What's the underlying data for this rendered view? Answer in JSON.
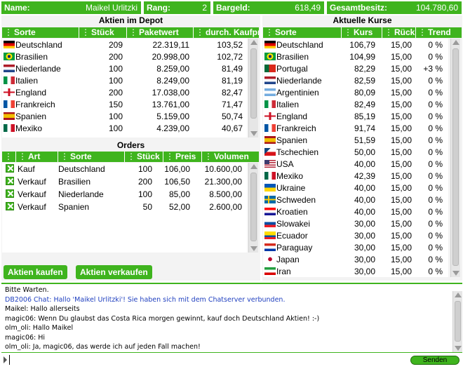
{
  "header": {
    "name_label": "Name:",
    "name_value": "Maikel Urlitzki",
    "rang_label": "Rang:",
    "rang_value": "2",
    "bargeld_label": "Bargeld:",
    "bargeld_value": "618,49",
    "gesamt_label": "Gesamtbesitz:",
    "gesamt_value": "104.780,60"
  },
  "depot": {
    "title": "Aktien im Depot",
    "columns": [
      "Sorte",
      "Stück",
      "Paketwert",
      "durch. Kaufpr."
    ],
    "rows": [
      {
        "flag": "de",
        "sorte": "Deutschland",
        "stueck": "209",
        "paketwert": "22.319,11",
        "kaufpr": "103,52"
      },
      {
        "flag": "br",
        "sorte": "Brasilien",
        "stueck": "200",
        "paketwert": "20.998,00",
        "kaufpr": "102,72"
      },
      {
        "flag": "nl",
        "sorte": "Niederlande",
        "stueck": "100",
        "paketwert": "8.259,00",
        "kaufpr": "81,49"
      },
      {
        "flag": "it",
        "sorte": "Italien",
        "stueck": "100",
        "paketwert": "8.249,00",
        "kaufpr": "81,19"
      },
      {
        "flag": "en",
        "sorte": "England",
        "stueck": "200",
        "paketwert": "17.038,00",
        "kaufpr": "82,47"
      },
      {
        "flag": "fr",
        "sorte": "Frankreich",
        "stueck": "150",
        "paketwert": "13.761,00",
        "kaufpr": "71,47"
      },
      {
        "flag": "es",
        "sorte": "Spanien",
        "stueck": "100",
        "paketwert": "5.159,00",
        "kaufpr": "50,74"
      },
      {
        "flag": "mx",
        "sorte": "Mexiko",
        "stueck": "100",
        "paketwert": "4.239,00",
        "kaufpr": "40,67"
      }
    ]
  },
  "orders": {
    "title": "Orders",
    "columns": [
      "Art",
      "Sorte",
      "Stück",
      "Preis",
      "Volumen"
    ],
    "rows": [
      {
        "art": "Kauf",
        "sorte": "Deutschland",
        "stueck": "100",
        "preis": "106,00",
        "volumen": "10.600,00"
      },
      {
        "art": "Verkauf",
        "sorte": "Brasilien",
        "stueck": "200",
        "preis": "106,50",
        "volumen": "21.300,00"
      },
      {
        "art": "Verkauf",
        "sorte": "Niederlande",
        "stueck": "100",
        "preis": "85,00",
        "volumen": "8.500,00"
      },
      {
        "art": "Verkauf",
        "sorte": "Spanien",
        "stueck": "50",
        "preis": "52,00",
        "volumen": "2.600,00"
      }
    ]
  },
  "buttons": {
    "kaufen": "Aktien kaufen",
    "verkaufen": "Aktien verkaufen",
    "senden": "Senden"
  },
  "kurse": {
    "title": "Aktuelle Kurse",
    "columns": [
      "Sorte",
      "Kurs",
      "Rückk.",
      "Trend"
    ],
    "rows": [
      {
        "flag": "de",
        "sorte": "Deutschland",
        "kurs": "106,79",
        "rueck": "15,00",
        "trend": "0 %"
      },
      {
        "flag": "br",
        "sorte": "Brasilien",
        "kurs": "104,99",
        "rueck": "15,00",
        "trend": "0 %"
      },
      {
        "flag": "pt",
        "sorte": "Portugal",
        "kurs": "82,29",
        "rueck": "15,00",
        "trend": "+3 %"
      },
      {
        "flag": "nl",
        "sorte": "Niederlande",
        "kurs": "82,59",
        "rueck": "15,00",
        "trend": "0 %"
      },
      {
        "flag": "ar",
        "sorte": "Argentinien",
        "kurs": "80,09",
        "rueck": "15,00",
        "trend": "0 %"
      },
      {
        "flag": "it",
        "sorte": "Italien",
        "kurs": "82,49",
        "rueck": "15,00",
        "trend": "0 %"
      },
      {
        "flag": "en",
        "sorte": "England",
        "kurs": "85,19",
        "rueck": "15,00",
        "trend": "0 %"
      },
      {
        "flag": "fr",
        "sorte": "Frankreich",
        "kurs": "91,74",
        "rueck": "15,00",
        "trend": "0 %"
      },
      {
        "flag": "es",
        "sorte": "Spanien",
        "kurs": "51,59",
        "rueck": "15,00",
        "trend": "0 %"
      },
      {
        "flag": "cz",
        "sorte": "Tschechien",
        "kurs": "50,00",
        "rueck": "15,00",
        "trend": "0 %"
      },
      {
        "flag": "us",
        "sorte": "USA",
        "kurs": "40,00",
        "rueck": "15,00",
        "trend": "0 %"
      },
      {
        "flag": "mx",
        "sorte": "Mexiko",
        "kurs": "42,39",
        "rueck": "15,00",
        "trend": "0 %"
      },
      {
        "flag": "ua",
        "sorte": "Ukraine",
        "kurs": "40,00",
        "rueck": "15,00",
        "trend": "0 %"
      },
      {
        "flag": "se",
        "sorte": "Schweden",
        "kurs": "40,00",
        "rueck": "15,00",
        "trend": "0 %"
      },
      {
        "flag": "hr",
        "sorte": "Kroatien",
        "kurs": "40,00",
        "rueck": "15,00",
        "trend": "0 %"
      },
      {
        "flag": "sk",
        "sorte": "Slowakei",
        "kurs": "30,00",
        "rueck": "15,00",
        "trend": "0 %"
      },
      {
        "flag": "ec",
        "sorte": "Ecuador",
        "kurs": "30,00",
        "rueck": "15,00",
        "trend": "0 %"
      },
      {
        "flag": "py",
        "sorte": "Paraguay",
        "kurs": "30,00",
        "rueck": "15,00",
        "trend": "0 %"
      },
      {
        "flag": "jp",
        "sorte": "Japan",
        "kurs": "30,00",
        "rueck": "15,00",
        "trend": "0 %"
      },
      {
        "flag": "ir",
        "sorte": "Iran",
        "kurs": "30,00",
        "rueck": "15,00",
        "trend": "0 %"
      }
    ]
  },
  "chat": {
    "lines": [
      {
        "text": "Bitte Warten.",
        "color": "#000000"
      },
      {
        "text": "DB2006 Chat: Hallo 'Maikel Urlitzki'! Sie haben sich mit dem Chatserver verbunden.",
        "color": "#1f3fbf"
      },
      {
        "text": "Maikel: Hallo allerseits",
        "color": "#000000"
      },
      {
        "text": "magic06: Wenn Du glaubst das Costa Rica morgen gewinnt, kauf doch Deutschland Aktien! :-)",
        "color": "#000000"
      },
      {
        "text": "olm_oli: Hallo Maikel",
        "color": "#000000"
      },
      {
        "text": "magic06: Hi",
        "color": "#000000"
      },
      {
        "text": "olm_oli: Ja, magic06, das werde ich auf jeden Fall machen!",
        "color": "#000000"
      }
    ],
    "input_value": ""
  },
  "colors": {
    "accent": "#3fb41e",
    "panel": "#f3f3f3"
  }
}
